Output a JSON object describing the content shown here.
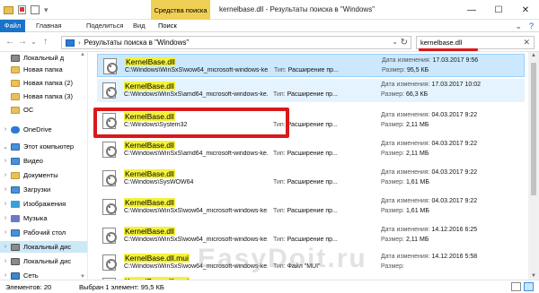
{
  "window": {
    "context_tab": "Средства поиска",
    "title": "kernelbase.dll - Результаты поиска в \"Windows\"",
    "minimize": "—",
    "maximize": "☐",
    "close": "✕"
  },
  "ribbon": {
    "tabs": [
      "Файл",
      "Главная",
      "Поделиться",
      "Вид",
      "Поиск"
    ],
    "expand": "⌄",
    "help": "?"
  },
  "address": {
    "back": "←",
    "forward": "→",
    "up_history": "⌄",
    "up": "↑",
    "separator": "›",
    "crumb": "Результаты поиска в \"Windows\"",
    "dropdown": "⌄",
    "refresh": "↻"
  },
  "search": {
    "value": "kernelbase.dll",
    "clear": "✕"
  },
  "sidebar": {
    "items": [
      {
        "label": "Локальный д",
        "icon": "disk-icon",
        "chev": "",
        "sel": false
      },
      {
        "label": "Новая папка",
        "icon": "folder-icon",
        "chev": "",
        "sel": false
      },
      {
        "label": "Новая папка (2)",
        "icon": "folder-icon",
        "chev": "",
        "sel": false
      },
      {
        "label": "Новая папка (3)",
        "icon": "folder-icon",
        "chev": "",
        "sel": false
      },
      {
        "label": "ОС",
        "icon": "folder-icon",
        "chev": "",
        "sel": false
      },
      {
        "label": "OneDrive",
        "icon": "cloud-icon",
        "chev": "›",
        "sel": false
      },
      {
        "label": "Этот компьютер",
        "icon": "computer-icon",
        "chev": "⌄",
        "sel": false
      },
      {
        "label": "Видео",
        "icon": "video-icon",
        "chev": "›",
        "sel": false
      },
      {
        "label": "Документы",
        "icon": "documents-icon",
        "chev": "›",
        "sel": false
      },
      {
        "label": "Загрузки",
        "icon": "downloads-icon",
        "chev": "›",
        "sel": false
      },
      {
        "label": "Изображения",
        "icon": "pictures-icon",
        "chev": "›",
        "sel": false
      },
      {
        "label": "Музыка",
        "icon": "music-icon",
        "chev": "›",
        "sel": false
      },
      {
        "label": "Рабочий стол",
        "icon": "desktop-icon",
        "chev": "›",
        "sel": false
      },
      {
        "label": "Локальный дис",
        "icon": "disk-icon",
        "chev": "›",
        "sel": true
      },
      {
        "label": "Локальный дис",
        "icon": "disk-icon",
        "chev": "›",
        "sel": false
      },
      {
        "label": "Сеть",
        "icon": "network-icon",
        "chev": "›",
        "sel": false
      }
    ],
    "scroll_up": "▲",
    "scroll_down": "▼"
  },
  "results": [
    {
      "name": "KernelBase.dll",
      "path": "C:\\Windows\\WinSxS\\wow64_microsoft-windows-ke...",
      "type_label": "Тип:",
      "type": "Расширение пр...",
      "date_label": "Дата изменения:",
      "date": "17.03.2017 9:56",
      "size_label": "Размер:",
      "size": "95,5 КБ",
      "state": "hl"
    },
    {
      "name": "KernelBase.dll",
      "path": "C:\\Windows\\WinSxS\\amd64_microsoft-windows-ke...",
      "type_label": "Тип:",
      "type": "Расширение пр...",
      "date_label": "Дата изменения:",
      "date": "17.03.2017 10:02",
      "size_label": "Размер:",
      "size": "66,3 КБ",
      "state": "hl2"
    },
    {
      "name": "KernelBase.dll",
      "path": "C:\\Windows\\System32",
      "type_label": "Тип:",
      "type": "Расширение пр...",
      "date_label": "Дата изменения:",
      "date": "04.03.2017 9:22",
      "size_label": "Размер:",
      "size": "2,11 МБ",
      "state": ""
    },
    {
      "name": "KernelBase.dll",
      "path": "C:\\Windows\\WinSxS\\amd64_microsoft-windows-ke...",
      "type_label": "Тип:",
      "type": "Расширение пр...",
      "date_label": "Дата изменения:",
      "date": "04.03.2017 9:22",
      "size_label": "Размер:",
      "size": "2,11 МБ",
      "state": ""
    },
    {
      "name": "KernelBase.dll",
      "path": "C:\\Windows\\SysWOW64",
      "type_label": "Тип:",
      "type": "Расширение пр...",
      "date_label": "Дата изменения:",
      "date": "04.03.2017 9:22",
      "size_label": "Размер:",
      "size": "1,61 МБ",
      "state": ""
    },
    {
      "name": "KernelBase.dll",
      "path": "C:\\Windows\\WinSxS\\wow64_microsoft-windows-ke...",
      "type_label": "Тип:",
      "type": "Расширение пр...",
      "date_label": "Дата изменения:",
      "date": "04.03.2017 9:22",
      "size_label": "Размер:",
      "size": "1,61 МБ",
      "state": ""
    },
    {
      "name": "KernelBase.dll",
      "path": "C:\\Windows\\WinSxS\\wow64_microsoft-windows-ke...",
      "type_label": "Тип:",
      "type": "Расширение пр...",
      "date_label": "Дата изменения:",
      "date": "14.12.2016 6:25",
      "size_label": "Размер:",
      "size": "2,11 МБ",
      "state": ""
    },
    {
      "name": "KernelBase.dll.mui",
      "path": "C:\\Windows\\WinSxS\\wow64_microsoft-windows-ke...",
      "type_label": "Тип:",
      "type": "Файл \"MUI\"",
      "date_label": "Дата изменения:",
      "date": "14.12.2016 5:58",
      "size_label": "Размер:",
      "size": "",
      "state": ""
    },
    {
      "name": "KernelBase.dll.mui",
      "path": "",
      "type_label": "",
      "type": "",
      "date_label": "",
      "date": "",
      "size_label": "",
      "size": "",
      "state": ""
    }
  ],
  "scroll": {
    "up": "▲",
    "down": "▼"
  },
  "status": {
    "count": "Элементов: 20",
    "selected": "Выбран 1 элемент: 95,5 КБ"
  },
  "watermark": "EasyDoit.ru"
}
